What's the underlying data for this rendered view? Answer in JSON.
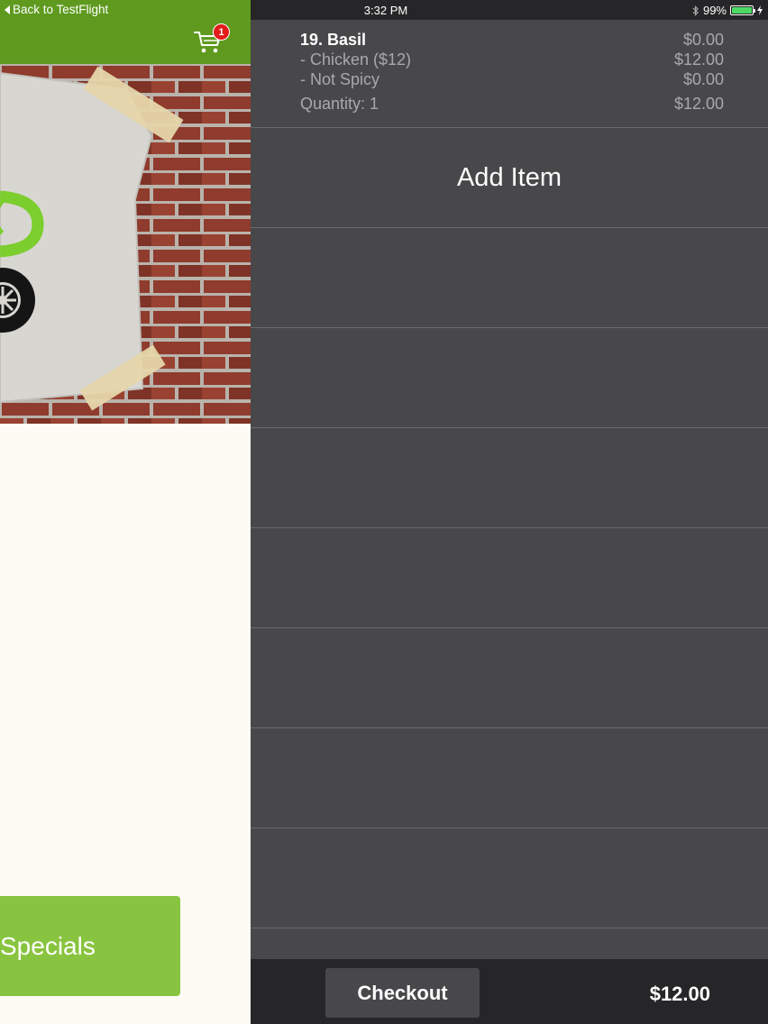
{
  "status_bar": {
    "back_label": "Back to TestFlight",
    "time": "3:32 PM",
    "battery": "99%",
    "battery_level": 0.99
  },
  "header": {
    "cart_badge_count": "1",
    "cart_icon": "shopping-cart-icon",
    "accent_color": "#5f9a1f"
  },
  "main": {
    "specials_label": "Specials",
    "specials_color": "#89c440"
  },
  "cart": {
    "items": [
      {
        "name": "19. Basil",
        "price": "$0.00",
        "options": [
          {
            "label": " - Chicken ($12)",
            "price": "$12.00"
          },
          {
            "label": " - Not Spicy",
            "price": "$0.00"
          }
        ],
        "quantity_label": "Quantity: 1",
        "line_total": "$12.00"
      }
    ],
    "add_item_label": "Add Item"
  },
  "footer": {
    "checkout_label": "Checkout",
    "total": "$12.00"
  }
}
